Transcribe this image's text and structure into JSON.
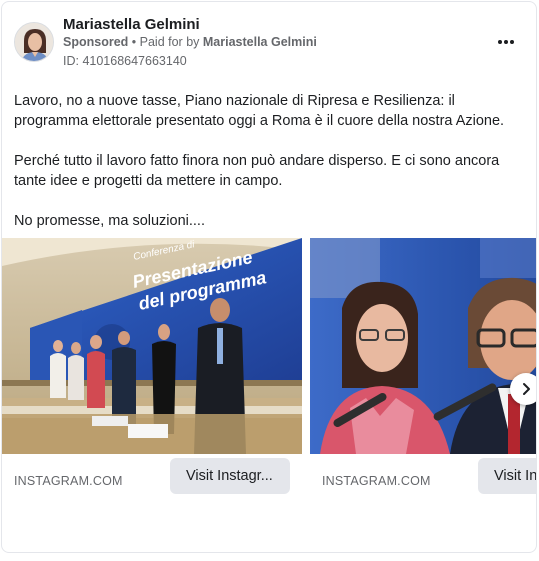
{
  "post": {
    "page_name": "Mariastella Gelmini",
    "sponsored_label": "Sponsored",
    "paid_for_prefix": "Paid for by",
    "paid_for_name": "Mariastella Gelmini",
    "ad_id": "ID: 410168647663140",
    "text_paragraphs": [
      "Lavoro, no a nuove tasse, Piano nazionale di Ripresa e Resilienza: il programma elettorale presentato oggi a Roma è il cuore della nostra Azione.",
      "Perché tutto il lavoro fatto finora non può andare disperso. E ci sono ancora tante idee e progetti da mettere in campo.",
      "No promesse, ma soluzioni...."
    ]
  },
  "carousel": {
    "cards": [
      {
        "domain": "INSTAGRAM.COM",
        "button_label": "Visit Instagr...",
        "image_text": [
          "Conferenza di",
          "Presentazione",
          "del programma"
        ]
      },
      {
        "domain": "INSTAGRAM.COM",
        "button_label": "Visit Ins"
      }
    ]
  },
  "icons": {
    "more": "more-horizontal-icon",
    "next": "chevron-right-icon"
  },
  "colors": {
    "text": "#1c1e21",
    "secondary_text": "#65676b",
    "button_bg": "#e4e6eb",
    "screen_blue": "#2b57b8"
  }
}
